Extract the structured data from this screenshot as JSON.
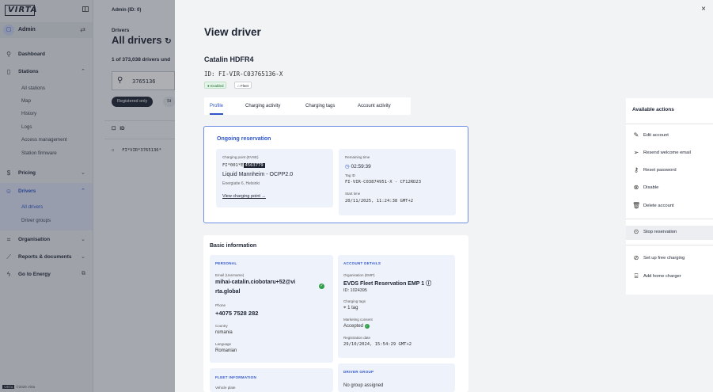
{
  "sidebar": {
    "logo": "VIRTA",
    "account": {
      "avatar": "▢",
      "name": "Admin"
    },
    "nav": {
      "dashboard": "Dashboard",
      "stations": "Stations",
      "stations_sub": [
        "All stations",
        "Map",
        "History",
        "Logs",
        "Access management",
        "Station firmware"
      ],
      "pricing": "Pricing",
      "drivers": "Drivers",
      "drivers_sub": [
        "All drivers",
        "Driver groups"
      ],
      "organisation": "Organisation",
      "reports": "Reports & documents",
      "go_to_energy": "Go to Energy"
    },
    "footer_tag": "VIRTA",
    "footer": "©2025 Virta"
  },
  "background": {
    "header": "Admin (ID: 0)",
    "breadcrumb": "Drivers",
    "title": "All drivers",
    "count": "1 of 373,038 drivers und",
    "search_value": "3765136",
    "chip_active": "Registered only",
    "chip_other": "St",
    "table_header": "ID",
    "row_id": "FI*VIR*3765136*"
  },
  "drawer": {
    "title": "View driver",
    "driver_name": "Catalin HDFR4",
    "driver_id": "ID: FI-VIR-C03765136-X",
    "badge_enabled": "● Enabled",
    "badge_fleet": "⌂ Fleet",
    "tabs": [
      "Profile",
      "Charging activity",
      "Charging tags",
      "Account activity"
    ],
    "reservation": {
      "title": "Ongoing reservation",
      "cp_label": "Charging point (EVSE)",
      "cp_prefix": "FI*001*E",
      "cp_highlight": "4563779",
      "cp_name": "Liquid Mannheim - OCPP2.0",
      "cp_address": "Energiatie 6, Helsinki",
      "cp_link": "View charging point →",
      "remaining_label": "Remaining time",
      "remaining_value": "02:59:39",
      "tag_label": "Tag ID",
      "tag_value": "FI-VIR-C03874951-X - CF12RD23",
      "start_label": "Start time",
      "start_value": "20/11/2025, 11:24:38 GMT+2"
    },
    "basic": {
      "title": "Basic information",
      "personal_label": "PERSONAL",
      "email_label": "Email (Username)",
      "email_value_1": "mihai-catalin.ciobotaru+52@vi",
      "email_value_2": "rta.global",
      "phone_label": "Phone",
      "phone_value": "+4075 7528 282",
      "country_label": "Country",
      "country_value": "romania",
      "language_label": "Language",
      "language_value": "Romanian",
      "account_label": "ACCOUNT DETAILS",
      "org_label": "Organisation (EMP)",
      "org_value": "EVDS Fleet Reservation EMP 1 ⓘ",
      "org_id": "ID: 1024395",
      "tags_label": "Charging tags",
      "tags_value": "1 tag",
      "marketing_label": "Marketing consent",
      "marketing_value": "Accepted",
      "registration_label": "Registration date",
      "registration_value": "29/10/2024, 15:54:29 GMT+2",
      "fleet_label": "FLEET INFORMATION",
      "vehicle_label": "Vehicle plate",
      "group_label": "DRIVER GROUP",
      "group_value": "No group assigned"
    },
    "actions": {
      "title": "Available actions",
      "items": [
        {
          "icon": "edit-icon",
          "label": "Edit account"
        },
        {
          "icon": "send-icon",
          "label": "Resend welcome email"
        },
        {
          "icon": "key-icon",
          "label": "Reset password"
        },
        {
          "icon": "disable-icon",
          "label": "Disable"
        },
        {
          "icon": "trash-icon",
          "label": "Delete account"
        },
        {
          "icon": "stop-icon",
          "label": "Stop reservation"
        },
        {
          "icon": "free-charging-icon",
          "label": "Set up free charging"
        },
        {
          "icon": "home-charger-icon",
          "label": "Add home charger"
        }
      ]
    },
    "close": "×"
  },
  "colors": {
    "accent": "#2f55c9",
    "success": "#2e9e48",
    "sidebar_bg": "#e9ebef"
  }
}
